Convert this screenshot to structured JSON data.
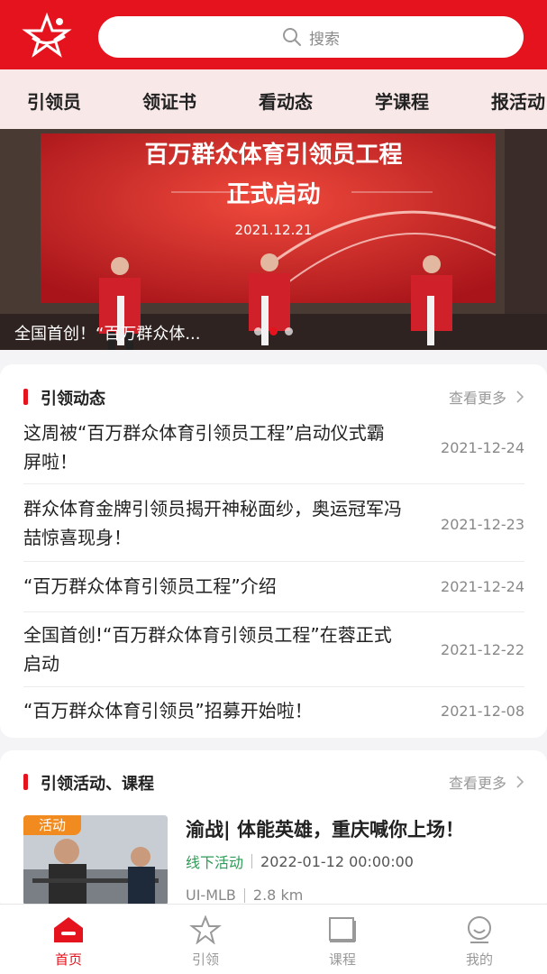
{
  "search": {
    "placeholder": "搜索"
  },
  "nav": [
    "引领员",
    "领证书",
    "看动态",
    "学课程",
    "报活动"
  ],
  "banner": {
    "title": "百万群众体育引领员工程",
    "subtitle": "正式启动",
    "date": "2021.12.21",
    "caption": "全国首创！“百万群众体...",
    "slide_count": 3,
    "active_slide": 1
  },
  "news_section": {
    "title": "引领动态",
    "more": "查看更多",
    "items": [
      {
        "title": "这周被“百万群众体育引领员工程”启动仪式霸屏啦！",
        "date": "2021-12-24"
      },
      {
        "title": "群众体育金牌引领员揭开神秘面纱，奥运冠军冯喆惊喜现身！",
        "date": "2021-12-23"
      },
      {
        "title": "“百万群众体育引领员工程”介绍",
        "date": "2021-12-24"
      },
      {
        "title": "全国首创!“百万群众体育引领员工程”在蓉正式启动",
        "date": "2021-12-22"
      },
      {
        "title": "“百万群众体育引领员”招募开始啦！",
        "date": "2021-12-08"
      }
    ]
  },
  "activity_section": {
    "title": "引领活动、课程",
    "more": "查看更多",
    "item": {
      "tag": "活动",
      "title": "渝战| 体能英雄，重庆喊你上场！",
      "type": "线下活动",
      "datetime": "2022-01-12 00:00:00",
      "location": "UI-MLB",
      "distance": "2.8 km"
    }
  },
  "tabbar": [
    {
      "label": "首页",
      "icon": "home-icon",
      "active": true
    },
    {
      "label": "引领",
      "icon": "star-icon",
      "active": false
    },
    {
      "label": "课程",
      "icon": "book-icon",
      "active": false
    },
    {
      "label": "我的",
      "icon": "user-icon",
      "active": false
    }
  ],
  "colors": {
    "brand": "#e5131d",
    "activity_tag": "#f28b1f",
    "offline_green": "#2e9b57"
  }
}
